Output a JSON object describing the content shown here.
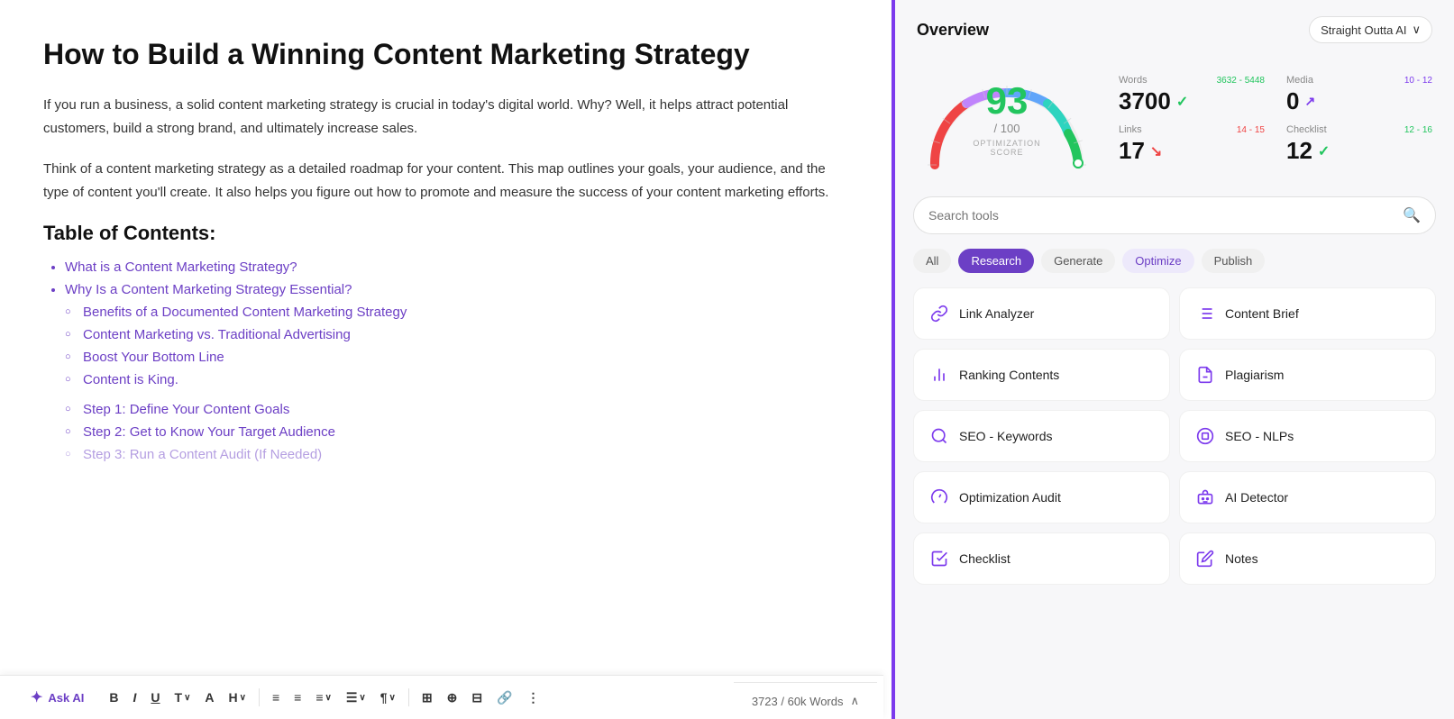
{
  "editor": {
    "title": "How to Build a Winning Content Marketing Strategy",
    "paragraphs": [
      "If you run a business, a solid content marketing strategy is crucial in today's digital world. Why? Well, it helps attract potential customers, build a strong brand, and ultimately increase sales.",
      "Think of a content marketing strategy as a detailed roadmap for your content. This map outlines your goals, your audience, and the type of content you'll create. It also helps you figure out how to promote and measure the success of your content marketing efforts."
    ],
    "toc_heading": "Table of Contents:",
    "toc_items": [
      "What is a Content Marketing Strategy?",
      "Why Is a Content Marketing Strategy Essential?"
    ],
    "toc_subitems": [
      "Benefits of a Documented Content Marketing Strategy",
      "Content Marketing vs. Traditional Advertising",
      "Boost Your Bottom Line",
      "Content is King."
    ],
    "toc_numbered": [
      "Step 1: Define Your Content Goals",
      "Step 2: Get to Know Your Target Audience",
      "Step 3: Run a Content Audit (If Needed)"
    ],
    "word_count": "3723 / 60k Words"
  },
  "toolbar": {
    "ask_ai_label": "Ask AI",
    "buttons": [
      "B",
      "I",
      "U",
      "T",
      "A",
      "H",
      "≡",
      "≡",
      "≡",
      "☰",
      "¶",
      "⊞",
      "⊕",
      "¶",
      "🔗",
      "⋮"
    ]
  },
  "sidebar": {
    "title": "Overview",
    "profile_badge": "Straight Outta AI",
    "score": {
      "value": "93",
      "total": "/ 100",
      "label": "OPTIMIZATION SCORE"
    },
    "stats": [
      {
        "label": "Words",
        "range": "3632 - 5448",
        "range_color": "green",
        "value": "3700",
        "icon": "✓",
        "icon_color": "green"
      },
      {
        "label": "Media",
        "range": "10 - 12",
        "range_color": "purple",
        "value": "0",
        "icon": "↗",
        "icon_color": "purple"
      },
      {
        "label": "Links",
        "range": "14 - 15",
        "range_color": "red",
        "value": "17",
        "icon": "↘",
        "icon_color": "red"
      },
      {
        "label": "Checklist",
        "range": "12 - 16",
        "range_color": "green",
        "value": "12",
        "icon": "✓",
        "icon_color": "green"
      }
    ],
    "search_placeholder": "Search tools",
    "filter_tabs": [
      {
        "label": "All",
        "state": "default"
      },
      {
        "label": "Research",
        "state": "active-purple"
      },
      {
        "label": "Generate",
        "state": "default"
      },
      {
        "label": "Optimize",
        "state": "active-light"
      },
      {
        "label": "Publish",
        "state": "default"
      }
    ],
    "tools": [
      {
        "name": "Link Analyzer",
        "icon": "link"
      },
      {
        "name": "Content Brief",
        "icon": "list"
      },
      {
        "name": "Ranking Contents",
        "icon": "chart"
      },
      {
        "name": "Plagiarism",
        "icon": "doc"
      },
      {
        "name": "SEO - Keywords",
        "icon": "search"
      },
      {
        "name": "SEO - NLPs",
        "icon": "target"
      },
      {
        "name": "Optimization Audit",
        "icon": "gauge"
      },
      {
        "name": "AI Detector",
        "icon": "robot"
      },
      {
        "name": "Checklist",
        "icon": "check"
      },
      {
        "name": "Notes",
        "icon": "pencil"
      }
    ]
  }
}
